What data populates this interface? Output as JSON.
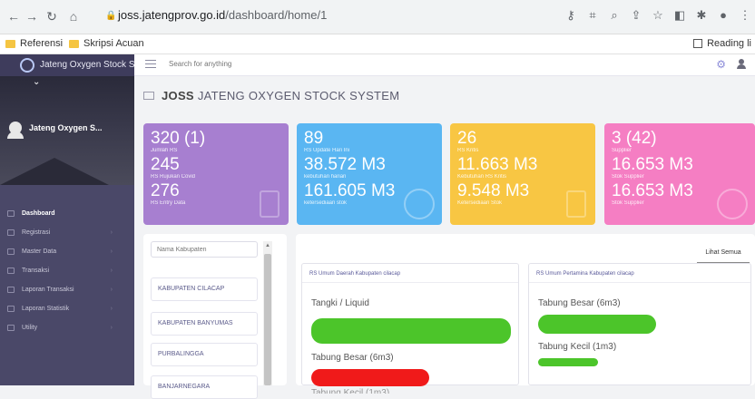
{
  "browser": {
    "url_host": "joss.jatengprov.go.id",
    "url_path": "/dashboard/home/1",
    "bookmarks": [
      "Referensi",
      "Skripsi Acuan"
    ],
    "reading_list": "Reading li"
  },
  "sidebar": {
    "brand": "Jateng Oxygen Stock Syst",
    "user": "Jateng Oxygen S...",
    "items": [
      {
        "label": "Dashboard",
        "active": true
      },
      {
        "label": "Registrasi",
        "active": false
      },
      {
        "label": "Master Data",
        "active": false
      },
      {
        "label": "Transaksi",
        "active": false
      },
      {
        "label": "Laporan Transaksi",
        "active": false
      },
      {
        "label": "Laporan Statistik",
        "active": false
      },
      {
        "label": "Utility",
        "active": false
      }
    ]
  },
  "header": {
    "search_placeholder": "Search for anything"
  },
  "page": {
    "title_bold": "JOSS",
    "title_rest": "JATENG OXYGEN STOCK SYSTEM"
  },
  "cards": [
    {
      "v1": "320 (1)",
      "l1": "Jumlah RS",
      "v2": "245",
      "l2": "RS Rujukan Covid",
      "v3": "276",
      "l3": "RS Entry Data",
      "color": "#a77fd0"
    },
    {
      "v1": "89",
      "l1": "RS Update Hari Ini",
      "v2": "38.572 M3",
      "l2": "kebutuhan harian",
      "v3": "161.605 M3",
      "l3": "ketersediaan stok",
      "color": "#5ab6f2"
    },
    {
      "v1": "26",
      "l1": "RS Kritis",
      "v2": "11.663 M3",
      "l2": "Kebutuhan RS Kritis",
      "v3": "9.548 M3",
      "l3": "Ketersediaan Stok",
      "color": "#f8c643"
    },
    {
      "v1": "3 (42)",
      "l1": "Supplier",
      "v2": "16.653 M3",
      "l2": "Stok Supplier",
      "v3": "16.653 M3",
      "l3": "Stok Supplier",
      "color": "#f57ec3"
    }
  ],
  "kabupaten": {
    "placeholder": "Nama Kabupaten",
    "items": [
      "KABUPATEN CILACAP",
      "KABUPATEN BANYUMAS",
      "PURBALINGGA",
      "BANJARNEGARA"
    ]
  },
  "panel": {
    "lihat_semua": "Lihat Semua",
    "rs": [
      {
        "title": "RS Umum Daerah Kabupaten cilacap",
        "items": [
          {
            "label": "Tangki / Liquid",
            "color": "#4cc52a"
          },
          {
            "label": "Tabung Besar (6m3)",
            "color": "#f01a1a"
          },
          {
            "label": "Tabung Kecil (1m3)",
            "color": "#4cc52a"
          }
        ]
      },
      {
        "title": "RS Umum Pertamina Kabupaten cilacap",
        "items": [
          {
            "label": "Tabung Besar (6m3)",
            "color": "#4cc52a"
          },
          {
            "label": "Tabung Kecil (1m3)",
            "color": "#4cc52a"
          }
        ]
      }
    ]
  }
}
